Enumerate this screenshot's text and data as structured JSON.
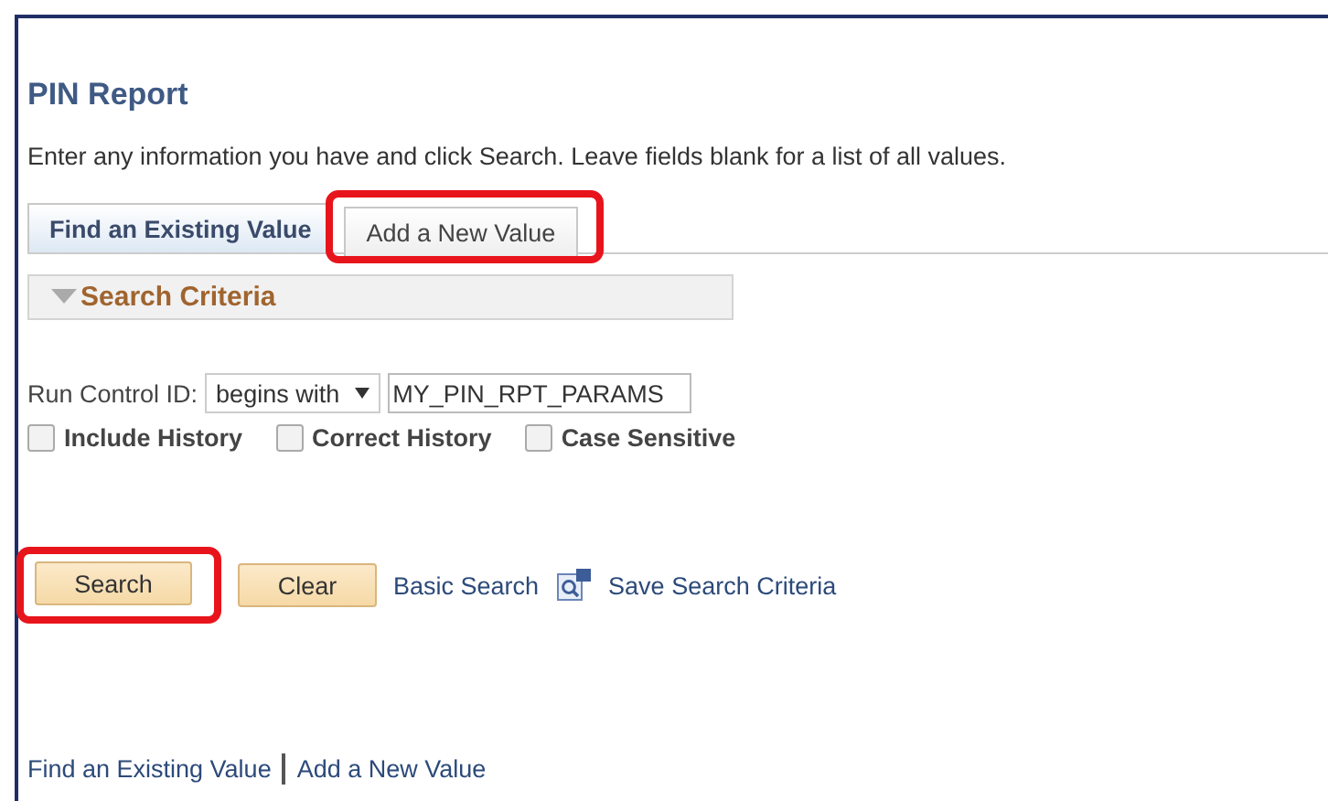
{
  "page": {
    "title": "PIN Report",
    "instructions": "Enter any information you have and click Search. Leave fields blank for a list of all values."
  },
  "tabs": [
    {
      "label": "Find an Existing Value",
      "selected": true,
      "highlighted": false
    },
    {
      "label": "Add a New Value",
      "selected": false,
      "highlighted": true
    }
  ],
  "search_criteria": {
    "heading": "Search Criteria",
    "expanded": true
  },
  "run_control": {
    "label": "Run Control ID:",
    "operator": "begins with",
    "value": "MY_PIN_RPT_PARAMS"
  },
  "checkboxes": [
    {
      "label": "Include History",
      "checked": false
    },
    {
      "label": "Correct History",
      "checked": false
    },
    {
      "label": "Case Sensitive",
      "checked": false
    }
  ],
  "buttons": [
    {
      "label": "Search",
      "highlighted": true
    },
    {
      "label": "Clear",
      "highlighted": false
    }
  ],
  "links": [
    "Basic Search",
    "Save Search Criteria"
  ],
  "footer_links": [
    "Find an Existing Value",
    "Add a New Value"
  ]
}
